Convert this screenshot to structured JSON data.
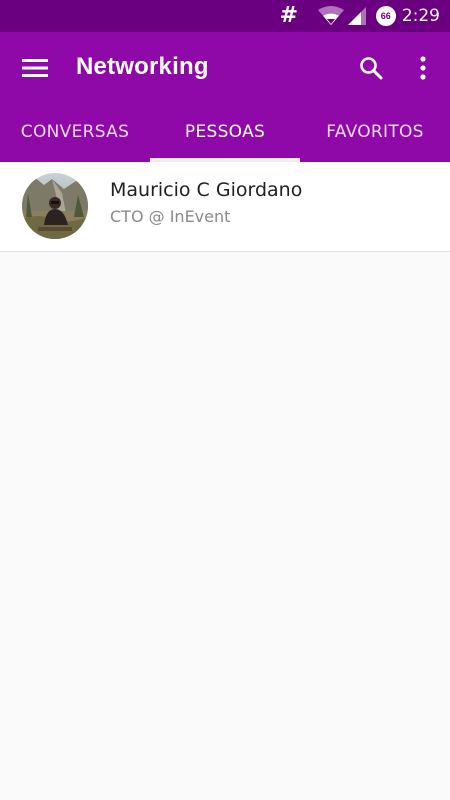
{
  "status_bar": {
    "notification_symbol": "#",
    "battery_level": "66",
    "time": "2:29"
  },
  "toolbar": {
    "title": "Networking"
  },
  "tabs": [
    {
      "label": "CONVERSAS",
      "selected": false
    },
    {
      "label": "PESSOAS",
      "selected": true
    },
    {
      "label": "FAVORITOS",
      "selected": false
    }
  ],
  "people": [
    {
      "name": "Mauricio C Giordano",
      "subtitle": "CTO @ InEvent"
    }
  ],
  "colors": {
    "status_bar": "#6a0080",
    "app_bar": "#8e09a8",
    "tab_indicator": "#eeeeee",
    "background": "#fafafa"
  },
  "icons": [
    "menu-icon",
    "search-icon",
    "more-vert-icon",
    "wifi-icon",
    "signal-icon",
    "battery-icon"
  ]
}
